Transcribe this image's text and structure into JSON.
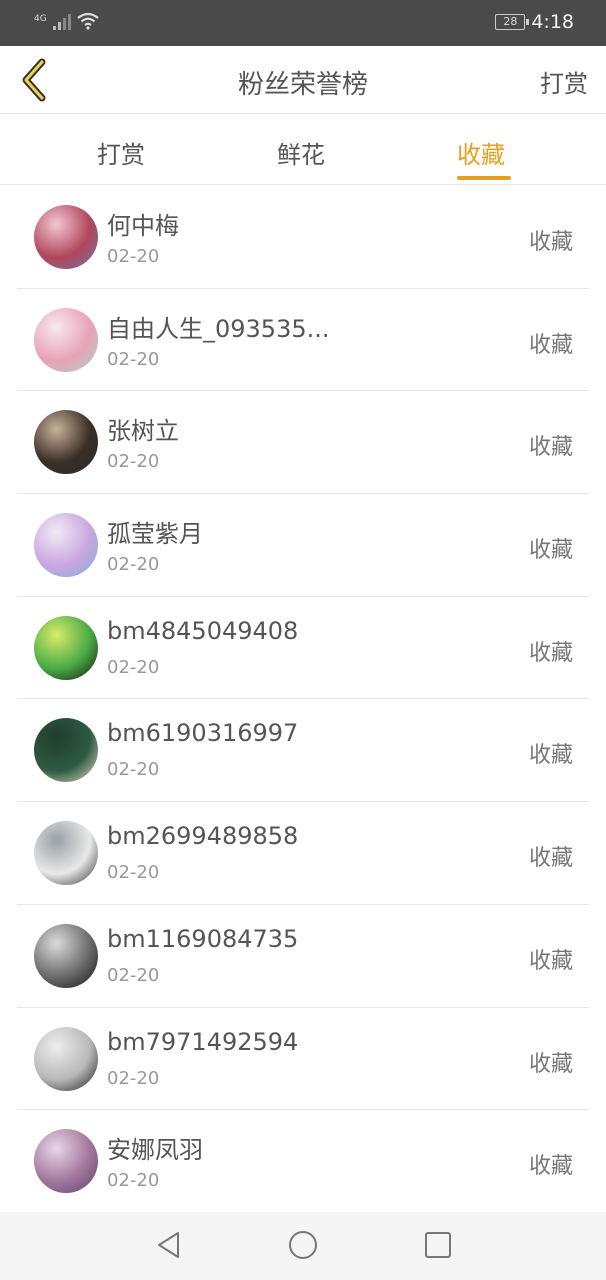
{
  "status_bar": {
    "network": "4G",
    "battery": "28",
    "time": "4:18"
  },
  "header": {
    "title": "粉丝荣誉榜",
    "action_label": "打赏"
  },
  "tabs": [
    {
      "label": "打赏",
      "active": false
    },
    {
      "label": "鲜花",
      "active": false
    },
    {
      "label": "收藏",
      "active": true
    }
  ],
  "list": [
    {
      "name": "何中梅",
      "date": "02-20",
      "action": "收藏",
      "avatar_colors": [
        "#f3c6d3",
        "#b0465a",
        "#6c7aa8"
      ]
    },
    {
      "name": "自由人生_093535...",
      "date": "02-20",
      "action": "收藏",
      "avatar_colors": [
        "#f8e8ee",
        "#e8a2b8",
        "#a9d4c6"
      ]
    },
    {
      "name": "张树立",
      "date": "02-20",
      "action": "收藏",
      "avatar_colors": [
        "#c9b29a",
        "#3a2e26",
        "#2a2a2a"
      ]
    },
    {
      "name": "孤莹紫月",
      "date": "02-20",
      "action": "收藏",
      "avatar_colors": [
        "#f1eaf6",
        "#c9a6e0",
        "#7fb0d8"
      ]
    },
    {
      "name": "bm4845049408",
      "date": "02-20",
      "action": "收藏",
      "avatar_colors": [
        "#d8ec6a",
        "#4aaa45",
        "#111111"
      ]
    },
    {
      "name": "bm6190316997",
      "date": "02-20",
      "action": "收藏",
      "avatar_colors": [
        "#1f3d2e",
        "#2e5a41",
        "#e8e0c8"
      ]
    },
    {
      "name": "bm2699489858",
      "date": "02-20",
      "action": "收藏",
      "avatar_colors": [
        "#9aa0a6",
        "#e8e8e8",
        "#2b2b2b"
      ]
    },
    {
      "name": "bm1169084735",
      "date": "02-20",
      "action": "收藏",
      "avatar_colors": [
        "#dcdcdc",
        "#6b6b6b",
        "#111111"
      ]
    },
    {
      "name": "bm7971492594",
      "date": "02-20",
      "action": "收藏",
      "avatar_colors": [
        "#eeeeee",
        "#b8b8b8",
        "#1a1a1a"
      ]
    },
    {
      "name": "安娜凤羽",
      "date": "02-20",
      "action": "收藏",
      "avatar_colors": [
        "#e8d6e6",
        "#a2769c",
        "#5a4468"
      ]
    }
  ],
  "colors": {
    "accent": "#e5a020",
    "status_bar": "#4a4a4a",
    "divider": "#e6e6e6"
  },
  "icons": {
    "back": "chevron-left-icon",
    "nav_back": "triangle-back-icon",
    "nav_home": "circle-home-icon",
    "nav_recent": "square-recent-icon"
  }
}
